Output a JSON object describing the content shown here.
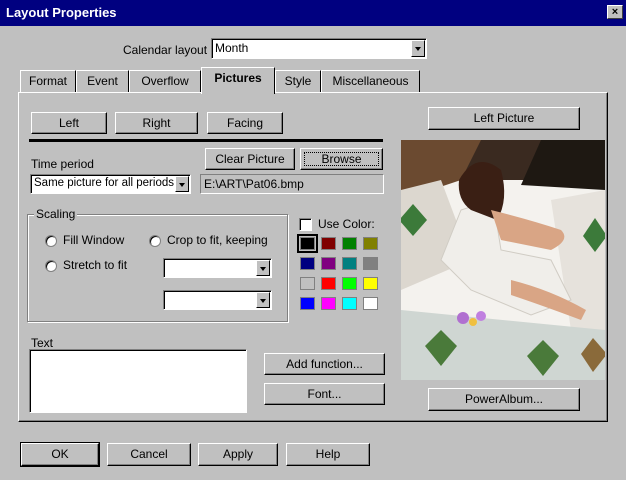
{
  "window": {
    "title": "Layout Properties",
    "close_glyph": "×"
  },
  "calendar_layout": {
    "label": "Calendar layout",
    "value": "Month"
  },
  "tabs": [
    {
      "label": "Format"
    },
    {
      "label": "Event"
    },
    {
      "label": "Overflow"
    },
    {
      "label": "Pictures",
      "active": true
    },
    {
      "label": "Style"
    },
    {
      "label": "Miscellaneous"
    }
  ],
  "pictures": {
    "left_label": "Left",
    "right_label": "Right",
    "facing_label": "Facing",
    "clear_picture_label": "Clear Picture",
    "browse_label": "Browse",
    "time_period_label": "Time period",
    "time_period_value": "Same picture for all periods",
    "file_path": "E:\\ART\\Pat06.bmp",
    "scaling_label": "Scaling",
    "fill_window_label": "Fill Window",
    "crop_label": "Crop to fit, keeping",
    "stretch_label": "Stretch to fit",
    "crop_select_1": "",
    "crop_select_2": "",
    "use_color_label": "Use Color:",
    "text_label": "Text",
    "text_value": "",
    "add_function_label": "Add function...",
    "font_label": "Font...",
    "preview_title": "Left Picture",
    "poweralbum_label": "PowerAlbum...",
    "colors": [
      "#000000",
      "#800000",
      "#008000",
      "#808000",
      "#000080",
      "#800080",
      "#008080",
      "#808080",
      "#c0c0c0",
      "#ff0000",
      "#00ff00",
      "#ffff00",
      "#0000ff",
      "#ff00ff",
      "#00ffff",
      "#ffffff"
    ],
    "selected_color": "#000000"
  },
  "footer": {
    "ok_label": "OK",
    "cancel_label": "Cancel",
    "apply_label": "Apply",
    "help_label": "Help"
  }
}
